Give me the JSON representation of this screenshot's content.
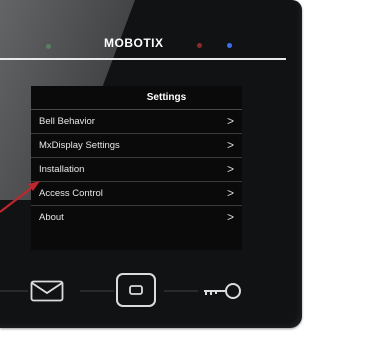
{
  "device": {
    "brand": "MOBOTIX",
    "leds": [
      "green",
      "red",
      "blue"
    ]
  },
  "settings": {
    "title": "Settings",
    "items": [
      {
        "label": "Bell Behavior",
        "arrow": ">"
      },
      {
        "label": "MxDisplay Settings",
        "arrow": ">"
      },
      {
        "label": "Installation",
        "arrow": ">"
      },
      {
        "label": "Access Control",
        "arrow": ">"
      },
      {
        "label": "About",
        "arrow": ">"
      }
    ]
  },
  "controls": {
    "left": "mail-icon",
    "center": "home-button-icon",
    "right": "key-icon"
  },
  "colors": {
    "bezel": "#111214",
    "screen": "#0a0a0a",
    "accent_red": "#c0262d",
    "led_blue": "#3b6ef2",
    "led_red": "#8b2a2a"
  }
}
